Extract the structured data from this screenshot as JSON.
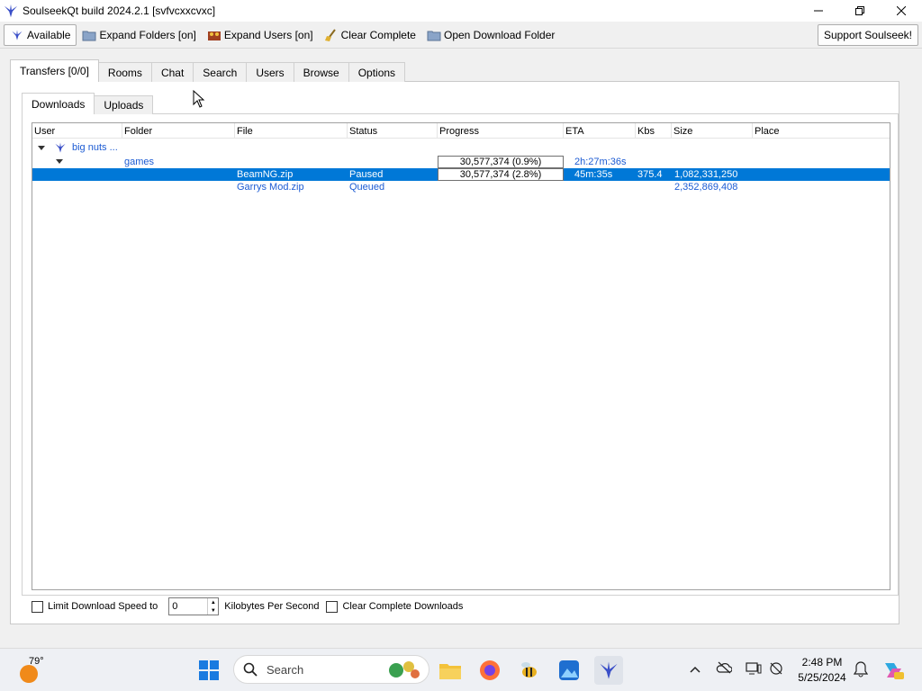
{
  "window": {
    "title": "SoulseekQt build 2024.2.1 [svfvcxxcvxc]"
  },
  "toolbar": {
    "available": "Available",
    "expand_folders": "Expand Folders [on]",
    "expand_users": "Expand Users [on]",
    "clear_complete": "Clear Complete",
    "open_download_folder": "Open Download Folder",
    "support": "Support Soulseek!"
  },
  "main_tabs": [
    "Transfers [0/0]",
    "Rooms",
    "Chat",
    "Search",
    "Users",
    "Browse",
    "Options"
  ],
  "sub_tabs": [
    "Downloads",
    "Uploads"
  ],
  "table": {
    "columns": [
      "User",
      "Folder",
      "File",
      "Status",
      "Progress",
      "ETA",
      "Kbs",
      "Size",
      "Place"
    ],
    "user_row": {
      "user": "big nuts ..."
    },
    "folder_row": {
      "folder": "games",
      "progress": "30,577,374 (0.9%)",
      "eta": "2h:27m:36s"
    },
    "files": [
      {
        "file": "BeamNG.zip",
        "status": "Paused",
        "progress": "30,577,374 (2.8%)",
        "eta": "45m:35s",
        "kbs": "375.4",
        "size": "1,082,331,250"
      },
      {
        "file": "Garrys Mod.zip",
        "status": "Queued",
        "size": "2,352,869,408"
      }
    ]
  },
  "bottom": {
    "limit_label": "Limit Download Speed to",
    "limit_value": "0",
    "unit": "Kilobytes Per Second",
    "clear_label": "Clear Complete Downloads"
  },
  "taskbar": {
    "temperature": "79°",
    "search_placeholder": "Search",
    "time": "2:48 PM",
    "date": "5/25/2024"
  },
  "colors": {
    "selection": "#0078d7",
    "link_blue": "#1c5bd3"
  }
}
